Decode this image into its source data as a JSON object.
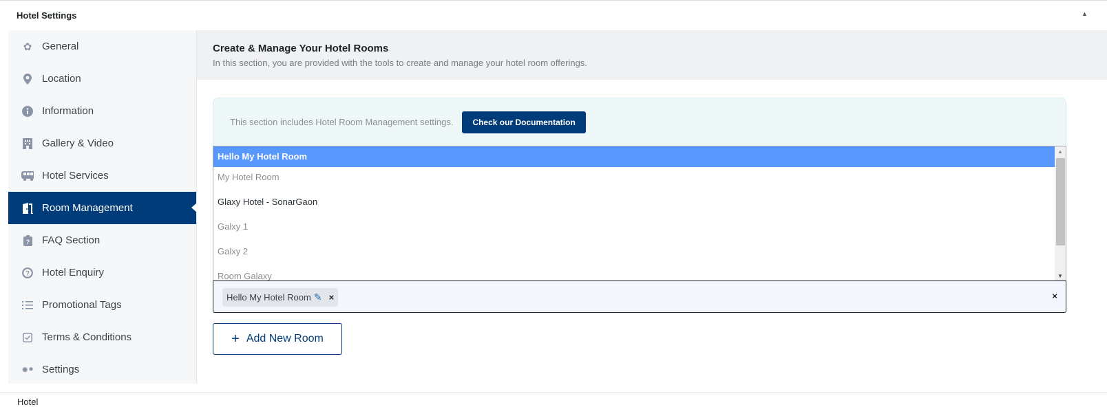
{
  "page": {
    "title": "Hotel Settings",
    "collapse_icon": "triangle-up-icon",
    "footer": "Hotel"
  },
  "sidebar": {
    "items": [
      {
        "label": "General",
        "icon": "gear-icon"
      },
      {
        "label": "Location",
        "icon": "map-pin-icon"
      },
      {
        "label": "Information",
        "icon": "info-circle-icon"
      },
      {
        "label": "Gallery & Video",
        "icon": "building-icon"
      },
      {
        "label": "Hotel Services",
        "icon": "bus-icon"
      },
      {
        "label": "Room Management",
        "icon": "door-open-icon",
        "active": true
      },
      {
        "label": "FAQ Section",
        "icon": "clipboard-question-icon"
      },
      {
        "label": "Hotel Enquiry",
        "icon": "question-circle-icon"
      },
      {
        "label": "Promotional Tags",
        "icon": "list-icon"
      },
      {
        "label": "Terms & Conditions",
        "icon": "checkbox-icon"
      },
      {
        "label": "Settings",
        "icon": "gears-icon"
      }
    ]
  },
  "main": {
    "title": "Create & Manage Your Hotel Rooms",
    "subtitle": "In this section, you are provided with the tools to create and manage your hotel room offerings.",
    "notice": "This section includes Hotel Room Management settings.",
    "doc_button": "Check our Documentation",
    "options": [
      "Hello My Hotel Room",
      "My Hotel Room",
      "Glaxy Hotel - SonarGaon",
      "Galxy 1",
      "Galxy 2",
      "Room Galaxy"
    ],
    "selected_tag": "Hello My Hotel Room",
    "add_button": "Add New Room"
  },
  "colors": {
    "accent": "#003c79",
    "highlight": "#5897fb"
  }
}
